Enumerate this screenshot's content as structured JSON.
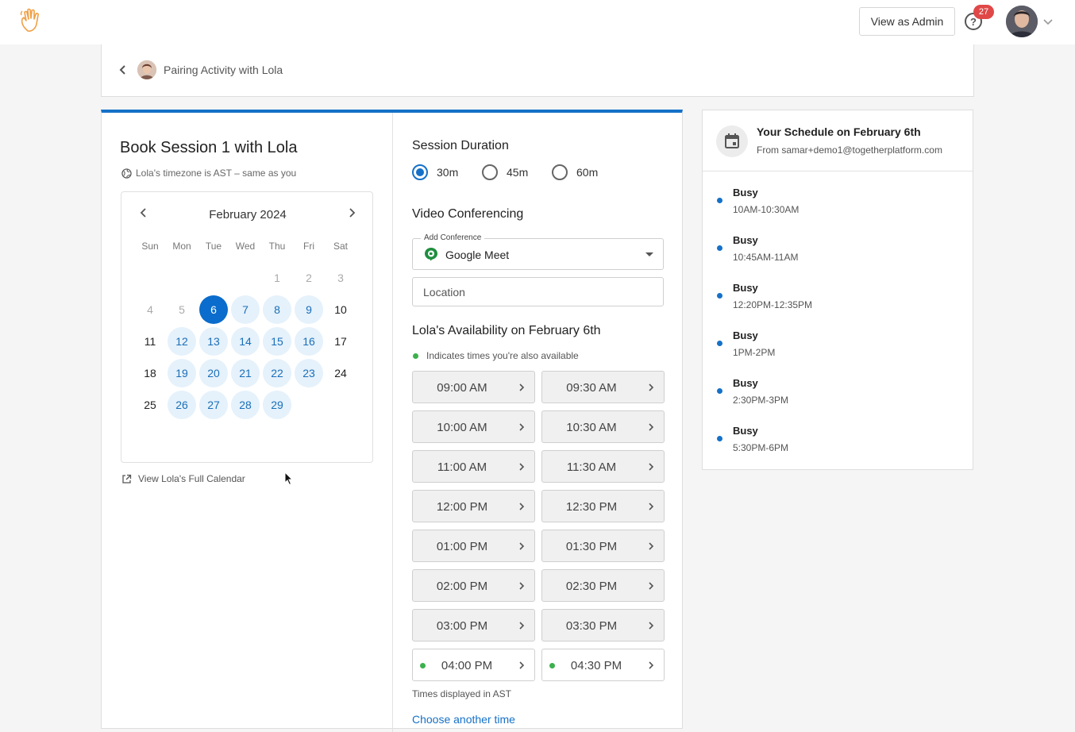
{
  "header": {
    "admin_button": "View as Admin",
    "notification_count": "27",
    "help_glyph": "?"
  },
  "breadcrumb": {
    "title": "Pairing Activity with Lola"
  },
  "booking": {
    "title": "Book Session 1 with Lola",
    "timezone_note": "Lola's timezone is AST – same as you",
    "view_calendar": "View Lola's Full Calendar"
  },
  "calendar": {
    "month": "February 2024",
    "weekdays": [
      "Sun",
      "Mon",
      "Tue",
      "Wed",
      "Thu",
      "Fri",
      "Sat"
    ],
    "days": [
      {
        "label": "1",
        "state": "dim"
      },
      {
        "label": "2",
        "state": "dim"
      },
      {
        "label": "3",
        "state": "dim"
      },
      {
        "label": "4",
        "state": "dim"
      },
      {
        "label": "5",
        "state": "dim"
      },
      {
        "label": "6",
        "state": "selected"
      },
      {
        "label": "7",
        "state": "available"
      },
      {
        "label": "8",
        "state": "available"
      },
      {
        "label": "9",
        "state": "available"
      },
      {
        "label": "10",
        "state": "plain"
      },
      {
        "label": "11",
        "state": "plain"
      },
      {
        "label": "12",
        "state": "available"
      },
      {
        "label": "13",
        "state": "available"
      },
      {
        "label": "14",
        "state": "available"
      },
      {
        "label": "15",
        "state": "available"
      },
      {
        "label": "16",
        "state": "available"
      },
      {
        "label": "17",
        "state": "plain"
      },
      {
        "label": "18",
        "state": "plain"
      },
      {
        "label": "19",
        "state": "available"
      },
      {
        "label": "20",
        "state": "available"
      },
      {
        "label": "21",
        "state": "available"
      },
      {
        "label": "22",
        "state": "available"
      },
      {
        "label": "23",
        "state": "available"
      },
      {
        "label": "24",
        "state": "plain"
      },
      {
        "label": "25",
        "state": "plain"
      },
      {
        "label": "26",
        "state": "available"
      },
      {
        "label": "27",
        "state": "available"
      },
      {
        "label": "28",
        "state": "available"
      },
      {
        "label": "29",
        "state": "available"
      }
    ]
  },
  "duration": {
    "label": "Session Duration",
    "options": [
      "30m",
      "45m",
      "60m"
    ],
    "selected": "30m"
  },
  "video": {
    "label": "Video Conferencing",
    "field_label": "Add Conference",
    "value": "Google Meet",
    "location_placeholder": "Location"
  },
  "availability": {
    "label": "Lola's Availability on February 6th",
    "legend": "Indicates times you're also available",
    "slots": [
      {
        "time": "09:00 AM",
        "mutual": false
      },
      {
        "time": "09:30 AM",
        "mutual": false
      },
      {
        "time": "10:00 AM",
        "mutual": false
      },
      {
        "time": "10:30 AM",
        "mutual": false
      },
      {
        "time": "11:00 AM",
        "mutual": false
      },
      {
        "time": "11:30 AM",
        "mutual": false
      },
      {
        "time": "12:00 PM",
        "mutual": false
      },
      {
        "time": "12:30 PM",
        "mutual": false
      },
      {
        "time": "01:00 PM",
        "mutual": false
      },
      {
        "time": "01:30 PM",
        "mutual": false
      },
      {
        "time": "02:00 PM",
        "mutual": false
      },
      {
        "time": "02:30 PM",
        "mutual": false
      },
      {
        "time": "03:00 PM",
        "mutual": false
      },
      {
        "time": "03:30 PM",
        "mutual": false
      },
      {
        "time": "04:00 PM",
        "mutual": true
      },
      {
        "time": "04:30 PM",
        "mutual": true
      }
    ],
    "tz_note": "Times displayed in AST",
    "another_time": "Choose another time"
  },
  "schedule": {
    "title": "Your Schedule on February 6th",
    "subtitle": "From samar+demo1@togetherplatform.com",
    "events": [
      {
        "title": "Busy",
        "time": "10AM-10:30AM"
      },
      {
        "title": "Busy",
        "time": "10:45AM-11AM"
      },
      {
        "title": "Busy",
        "time": "12:20PM-12:35PM"
      },
      {
        "title": "Busy",
        "time": "1PM-2PM"
      },
      {
        "title": "Busy",
        "time": "2:30PM-3PM"
      },
      {
        "title": "Busy",
        "time": "5:30PM-6PM"
      }
    ]
  },
  "colors": {
    "primary": "#1571c8",
    "selected_day": "#0a6ccc",
    "available_day_bg": "#e5f1fb",
    "mutual_dot": "#3cb04c",
    "badge": "#e04848",
    "logo": "#f0a045"
  }
}
